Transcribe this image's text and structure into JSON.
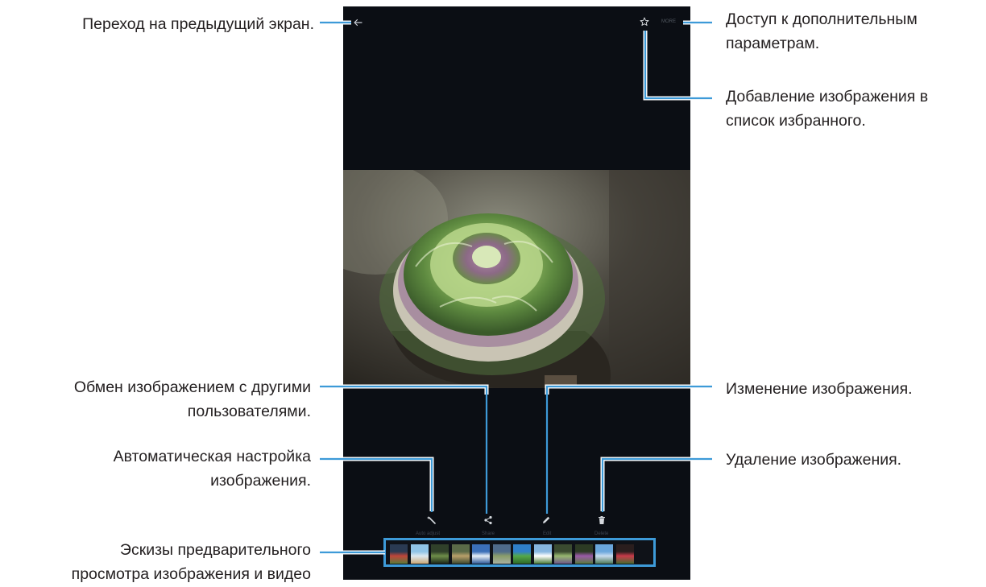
{
  "callouts": {
    "back": "Переход на предыдущий экран.",
    "more_1": "Доступ к дополнительным",
    "more_2": "параметрам.",
    "favorite_1": "Добавление изображения в",
    "favorite_2": "список избранного.",
    "share_1": "Обмен изображением с другими",
    "share_2": "пользователями.",
    "auto_1": "Автоматическая настройка",
    "auto_2": "изображения.",
    "edit": "Изменение изображения.",
    "delete": "Удаление изображения.",
    "thumbs_1": "Эскизы предварительного",
    "thumbs_2": "просмотра изображения и видео"
  },
  "screen": {
    "more_label": "MORE",
    "toolbar": {
      "auto_adjust": "Auto adjust",
      "share": "Share",
      "edit": "Edit",
      "delete": "Delete"
    }
  },
  "icons": {
    "back": "arrow-left-icon",
    "favorite": "star-outline-icon",
    "auto_adjust": "magic-wand-icon",
    "share": "share-icon",
    "edit": "pencil-icon",
    "delete": "trash-icon"
  },
  "colors": {
    "leader": "#3d9ad8",
    "screen_bg": "#0b0e14",
    "text": "#231f20"
  },
  "thumbnails": [
    {
      "name": "thumb-flower-red",
      "colors": [
        "#2a3a52",
        "#c0453a",
        "#5c7a3a"
      ]
    },
    {
      "name": "thumb-beach",
      "colors": [
        "#8fc3e6",
        "#dce8f0",
        "#caa878"
      ]
    },
    {
      "name": "thumb-leaves",
      "colors": [
        "#30402a",
        "#6f8f4a",
        "#1c2618"
      ]
    },
    {
      "name": "thumb-tree",
      "colors": [
        "#5a6a48",
        "#b9a06a",
        "#3e4a30"
      ]
    },
    {
      "name": "thumb-sky",
      "colors": [
        "#3b6fb8",
        "#e8f0f8",
        "#2f5a9a"
      ]
    },
    {
      "name": "thumb-cliffs",
      "colors": [
        "#4f6b8a",
        "#8a9d6a",
        "#a8b0a0"
      ]
    },
    {
      "name": "thumb-field",
      "colors": [
        "#2f7fc8",
        "#54a84a",
        "#2e6a28"
      ]
    },
    {
      "name": "thumb-clouds",
      "colors": [
        "#86b6e0",
        "#ffffff",
        "#4c7e3a"
      ]
    },
    {
      "name": "thumb-plant",
      "colors": [
        "#3a4a30",
        "#98b870",
        "#6e5a8a"
      ]
    },
    {
      "name": "thumb-thistle",
      "colors": [
        "#2c3a24",
        "#9a5aa8",
        "#5a7a40"
      ]
    },
    {
      "name": "thumb-bluesky",
      "colors": [
        "#6aa6dc",
        "#c8dcf0",
        "#4f7a5a"
      ]
    },
    {
      "name": "thumb-roses",
      "colors": [
        "#2a1e1e",
        "#c83a4a",
        "#4a6a30"
      ]
    }
  ]
}
